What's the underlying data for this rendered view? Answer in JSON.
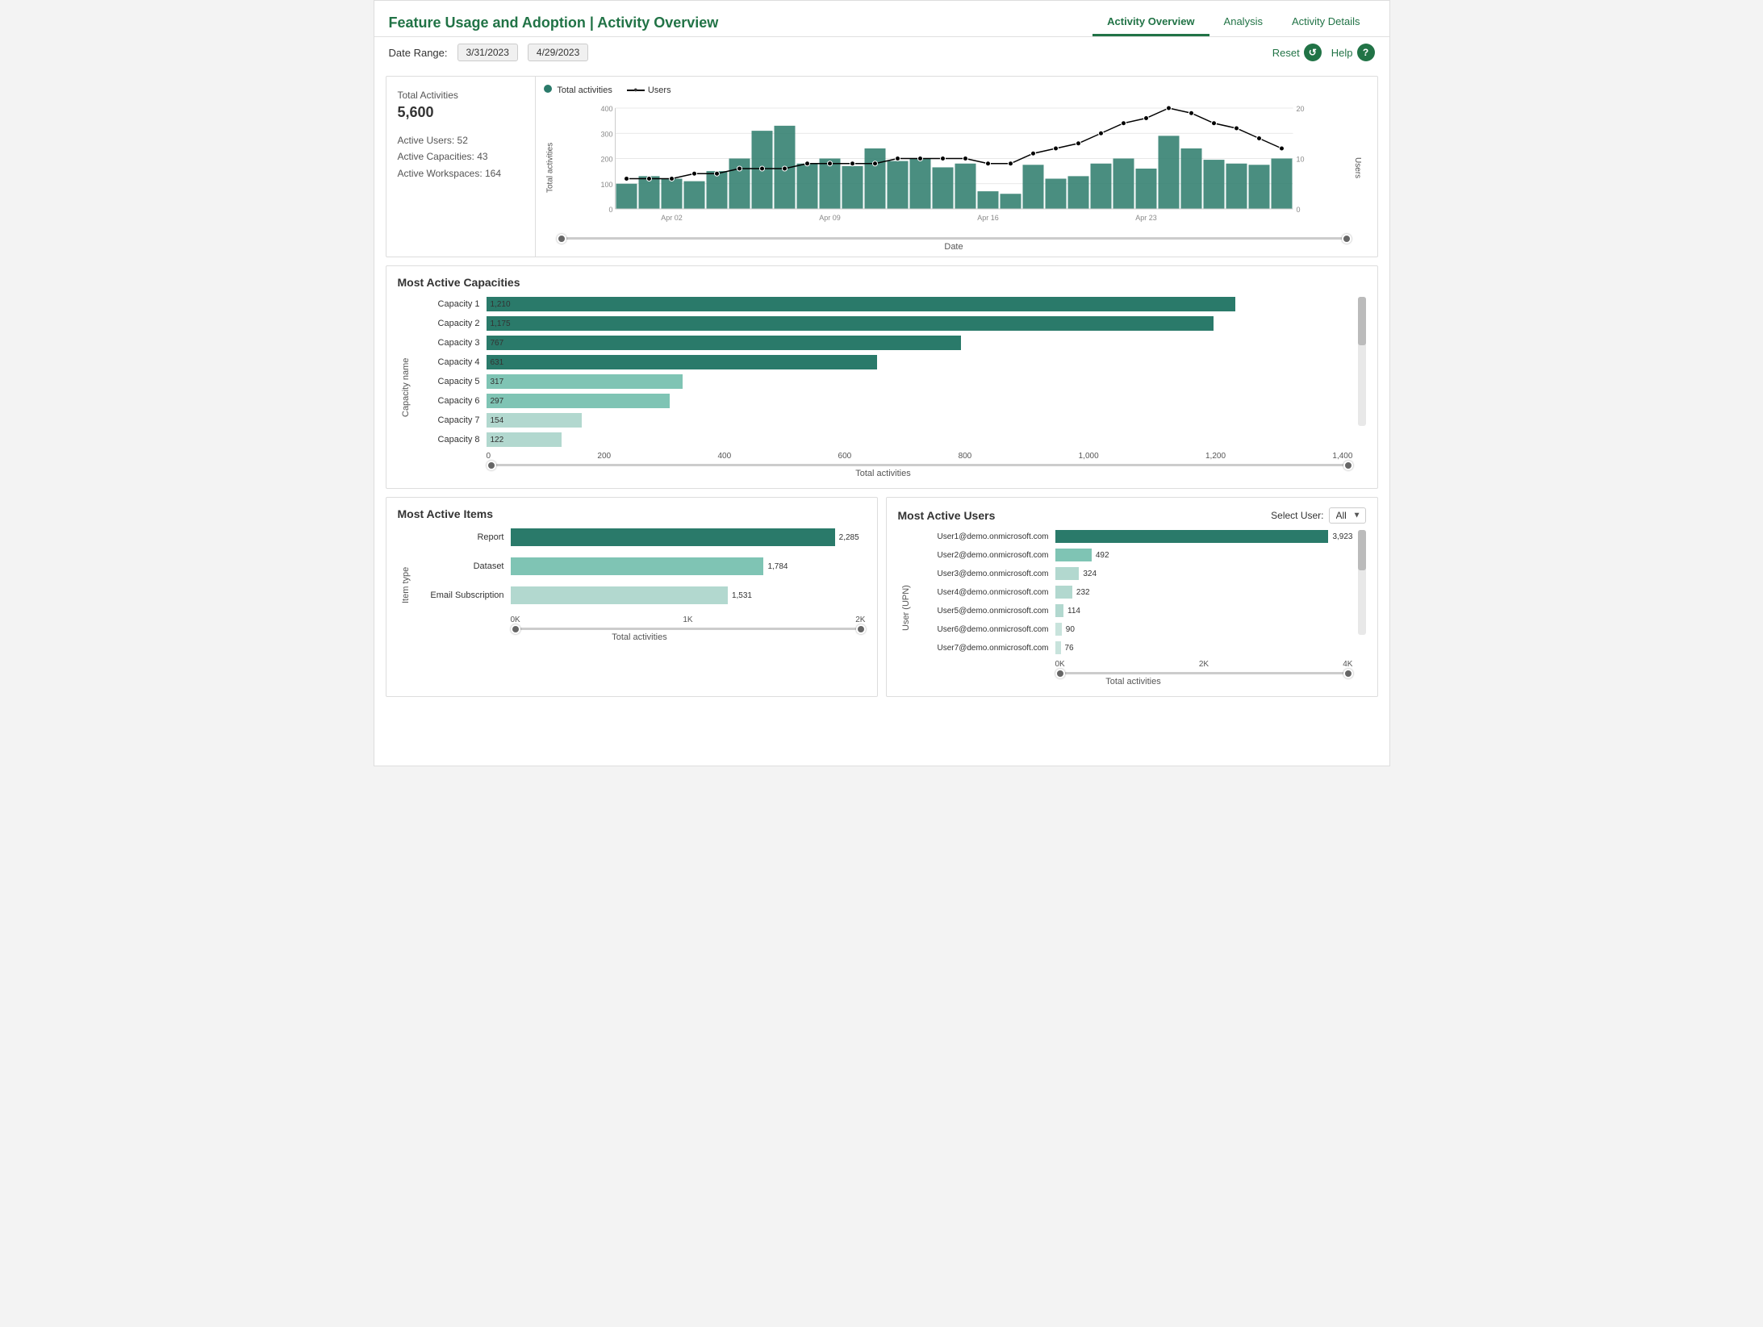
{
  "header": {
    "title": "Feature Usage and Adoption | Activity Overview",
    "nav": [
      {
        "label": "Activity Overview",
        "active": true
      },
      {
        "label": "Analysis",
        "active": false
      },
      {
        "label": "Activity Details",
        "active": false
      }
    ],
    "reset_label": "Reset",
    "help_label": "Help"
  },
  "toolbar": {
    "date_range_label": "Date Range:",
    "date_start": "3/31/2023",
    "date_end": "4/29/2023"
  },
  "stats": {
    "total_activities_label": "Total Activities",
    "total_activities_value": "5,600",
    "active_users_label": "Active Users:",
    "active_users_value": "52",
    "active_capacities_label": "Active Capacities:",
    "active_capacities_value": "43",
    "active_workspaces_label": "Active Workspaces:",
    "active_workspaces_value": "164"
  },
  "time_chart": {
    "legend_activities": "Total activities",
    "legend_users": "Users",
    "x_axis_label": "Date",
    "y_left_label": "Total activities",
    "y_right_label": "Users",
    "bars": [
      {
        "date": "Mar 31",
        "val": 100
      },
      {
        "date": "Apr 01",
        "val": 130
      },
      {
        "date": "Apr 02",
        "val": 120
      },
      {
        "date": "Apr 03",
        "val": 110
      },
      {
        "date": "Apr 04",
        "val": 150
      },
      {
        "date": "Apr 05",
        "val": 200
      },
      {
        "date": "Apr 06",
        "val": 310
      },
      {
        "date": "Apr 07",
        "val": 330
      },
      {
        "date": "Apr 08",
        "val": 180
      },
      {
        "date": "Apr 09",
        "val": 200
      },
      {
        "date": "Apr 10",
        "val": 170
      },
      {
        "date": "Apr 11",
        "val": 240
      },
      {
        "date": "Apr 12",
        "val": 190
      },
      {
        "date": "Apr 13",
        "val": 200
      },
      {
        "date": "Apr 14",
        "val": 165
      },
      {
        "date": "Apr 15",
        "val": 180
      },
      {
        "date": "Apr 16",
        "val": 70
      },
      {
        "date": "Apr 17",
        "val": 60
      },
      {
        "date": "Apr 18",
        "val": 175
      },
      {
        "date": "Apr 19",
        "val": 120
      },
      {
        "date": "Apr 20",
        "val": 130
      },
      {
        "date": "Apr 21",
        "val": 180
      },
      {
        "date": "Apr 22",
        "val": 200
      },
      {
        "date": "Apr 23",
        "val": 160
      },
      {
        "date": "Apr 24",
        "val": 290
      },
      {
        "date": "Apr 25",
        "val": 240
      },
      {
        "date": "Apr 26",
        "val": 195
      },
      {
        "date": "Apr 27",
        "val": 180
      },
      {
        "date": "Apr 28",
        "val": 175
      },
      {
        "date": "Apr 29",
        "val": 200
      }
    ],
    "users_line": [
      6,
      6,
      6,
      7,
      7,
      8,
      8,
      8,
      9,
      9,
      9,
      9,
      10,
      10,
      10,
      10,
      9,
      9,
      11,
      12,
      13,
      15,
      17,
      18,
      20,
      19,
      17,
      16,
      14,
      12
    ],
    "x_labels": [
      "Apr 02",
      "Apr 09",
      "Apr 16",
      "Apr 23"
    ],
    "y_left_max": 400,
    "y_right_max": 20
  },
  "capacities": {
    "section_title": "Most Active Capacities",
    "y_label": "Capacity name",
    "x_label": "Total activities",
    "x_ticks": [
      "0",
      "200",
      "400",
      "600",
      "800",
      "1,000",
      "1,200",
      "1,400"
    ],
    "max": 1400,
    "items": [
      {
        "name": "Capacity 1",
        "value": 1210,
        "color": "#2a7a6a"
      },
      {
        "name": "Capacity 2",
        "value": 1175,
        "color": "#2a7a6a"
      },
      {
        "name": "Capacity 3",
        "value": 767,
        "color": "#2a7a6a"
      },
      {
        "name": "Capacity 4",
        "value": 631,
        "color": "#2a7a6a"
      },
      {
        "name": "Capacity 5",
        "value": 317,
        "color": "#7fc4b4"
      },
      {
        "name": "Capacity 6",
        "value": 297,
        "color": "#7fc4b4"
      },
      {
        "name": "Capacity 7",
        "value": 154,
        "color": "#b2d8cf"
      },
      {
        "name": "Capacity 8",
        "value": 122,
        "color": "#b2d8cf"
      }
    ]
  },
  "active_items": {
    "section_title": "Most Active Items",
    "y_label": "Item type",
    "x_label": "Total activities",
    "x_ticks": [
      "0K",
      "1K",
      "2K"
    ],
    "max": 2500,
    "items": [
      {
        "name": "Report",
        "value": 2285,
        "color": "#2a7a6a"
      },
      {
        "name": "Dataset",
        "value": 1784,
        "color": "#7fc4b4"
      },
      {
        "name": "Email Subscription",
        "value": 1531,
        "color": "#b2d8cf"
      }
    ]
  },
  "active_users": {
    "section_title": "Most Active Users",
    "select_label": "Select User:",
    "select_value": "All",
    "y_label": "User (UPN)",
    "x_label": "Total activities",
    "x_ticks": [
      "0K",
      "2K",
      "4K"
    ],
    "max": 4000,
    "items": [
      {
        "name": "User1@demo.onmicrosoft.com",
        "value": 3923,
        "color": "#2a7a6a"
      },
      {
        "name": "User2@demo.onmicrosoft.com",
        "value": 492,
        "color": "#7fc4b4"
      },
      {
        "name": "User3@demo.onmicrosoft.com",
        "value": 324,
        "color": "#b2d8cf"
      },
      {
        "name": "User4@demo.onmicrosoft.com",
        "value": 232,
        "color": "#b2d8cf"
      },
      {
        "name": "User5@demo.onmicrosoft.com",
        "value": 114,
        "color": "#b2d8cf"
      },
      {
        "name": "User6@demo.onmicrosoft.com",
        "value": 90,
        "color": "#c8e3dc"
      },
      {
        "name": "User7@demo.onmicrosoft.com",
        "value": 76,
        "color": "#c8e3dc"
      }
    ]
  }
}
